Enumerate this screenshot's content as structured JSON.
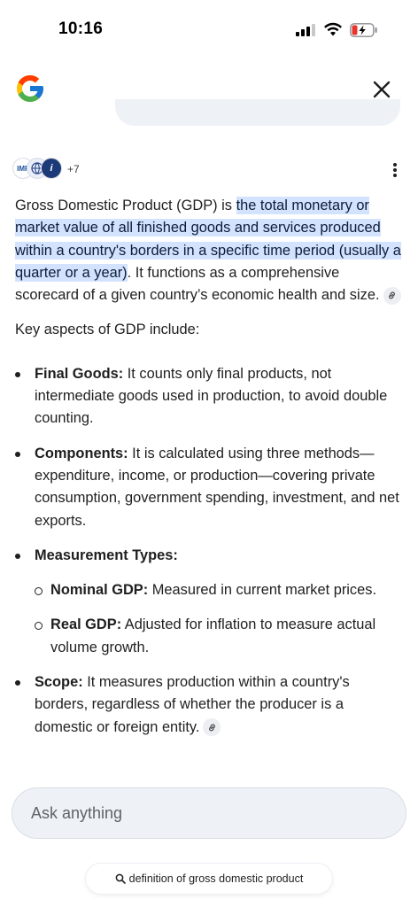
{
  "status": {
    "time": "10:16"
  },
  "header": {
    "logo_icon": "google-g-icon",
    "close_icon": "close-icon"
  },
  "sources": {
    "source_1": "IMF",
    "more_count": "+7"
  },
  "answer": {
    "intro_before": "Gross Domestic Product (GDP) is ",
    "intro_highlight": "the total monetary or market value of all finished goods and services produced within a country's borders in a specific time period (usually a quarter or a year)",
    "intro_after": ". It functions as a comprehensive scorecard of a given country’s economic health and size.",
    "key_aspects": "Key aspects of GDP include:",
    "bullets": [
      {
        "title": "Final Goods:",
        "text": " It counts only final products, not intermediate goods used in production, to avoid double counting."
      },
      {
        "title": "Components:",
        "text": " It is calculated using three methods—expenditure, income, or production—covering private consumption, government spending, investment, and net exports."
      },
      {
        "title": "Measurement Types:",
        "text": ""
      },
      {
        "title": "Scope:",
        "text": " It measures production within a country's borders, regardless of whether the producer is a domestic or foreign entity."
      }
    ],
    "sub_bullets": [
      {
        "title": "Nominal GDP:",
        "text": " Measured in current market prices."
      },
      {
        "title": "Real GDP:",
        "text": " Adjusted for inflation to measure actual volume growth."
      }
    ]
  },
  "ask": {
    "placeholder": "Ask anything"
  },
  "suggestion": {
    "label": "definition of gross domestic product"
  },
  "colors": {
    "highlight": "#d3e3fd",
    "ask_bg": "#eef1f6"
  }
}
